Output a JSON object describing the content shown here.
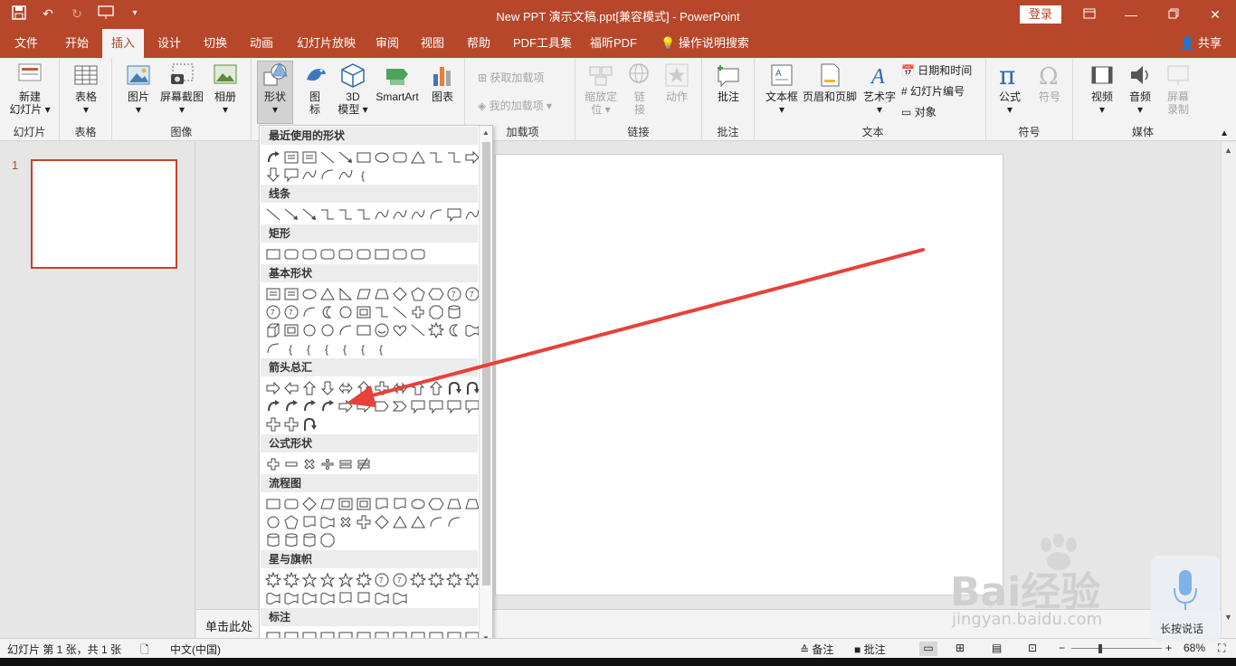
{
  "window": {
    "title": "New PPT 演示文稿.ppt[兼容模式]  -  PowerPoint",
    "login_label": "登录",
    "controls": [
      "restore-ribbon",
      "minimize",
      "maximize",
      "close"
    ]
  },
  "tabs": [
    {
      "label": "文件"
    },
    {
      "label": "开始"
    },
    {
      "label": "插入",
      "active": true
    },
    {
      "label": "设计"
    },
    {
      "label": "切换"
    },
    {
      "label": "动画"
    },
    {
      "label": "幻灯片放映"
    },
    {
      "label": "审阅"
    },
    {
      "label": "视图"
    },
    {
      "label": "帮助"
    },
    {
      "label": "PDF工具集"
    },
    {
      "label": "福昕PDF"
    },
    {
      "label": "操作说明搜索"
    }
  ],
  "share_label": "共享",
  "ribbon": {
    "groups": [
      {
        "label": "幻灯片",
        "buttons": [
          "新建\n幻灯片"
        ]
      },
      {
        "label": "表格",
        "buttons": [
          "表格"
        ]
      },
      {
        "label": "图像",
        "buttons": [
          "图片",
          "屏幕截图",
          "相册"
        ]
      },
      {
        "label": "插图",
        "buttons": [
          "形状",
          "图标",
          "3D 模型",
          "SmartArt",
          "图表"
        ]
      },
      {
        "label": "加载项",
        "buttons": [
          "获取加载项",
          "我的加载项"
        ]
      },
      {
        "label": "链接",
        "buttons": [
          "缩放定位",
          "链接",
          "动作"
        ]
      },
      {
        "label": "批注",
        "buttons": [
          "批注"
        ]
      },
      {
        "label": "文本",
        "buttons": [
          "文本框",
          "页眉和页脚",
          "艺术字",
          "日期和时间",
          "幻灯片编号",
          "对象"
        ]
      },
      {
        "label": "符号",
        "buttons": [
          "公式",
          "符号"
        ]
      },
      {
        "label": "媒体",
        "buttons": [
          "视频",
          "音频",
          "屏幕\n录制"
        ]
      }
    ],
    "new_slide_1": "新建",
    "new_slide_2": "幻灯片",
    "icon1": "图",
    "icon2": "标",
    "model_1": "3D",
    "model_2": "模型",
    "zoom_1": "缩放定",
    "zoom_2": "位",
    "link_1": "链",
    "link_2": "接",
    "rec_1": "屏幕",
    "rec_2": "录制"
  },
  "shapes_panel": {
    "sections": [
      {
        "title": "最近使用的形状"
      },
      {
        "title": "线条"
      },
      {
        "title": "矩形"
      },
      {
        "title": "基本形状"
      },
      {
        "title": "箭头总汇"
      },
      {
        "title": "公式形状"
      },
      {
        "title": "流程图"
      },
      {
        "title": "星与旗帜"
      },
      {
        "title": "标注"
      }
    ]
  },
  "slides": [
    {
      "number": "1"
    }
  ],
  "notes_placeholder": "单击此处",
  "statusbar": {
    "slide_info": "幻灯片 第 1 张，共 1 张",
    "language": "中文(中国)",
    "notes_label": "备注",
    "comments_label": "批注",
    "zoom": "68%"
  },
  "watermark": {
    "brand": "Bai经验",
    "url": "jingyan.baidu.com"
  },
  "voice_button_label": "长按说话",
  "colors": {
    "accent": "#b7472a",
    "annotation_arrow": "#e8403a"
  }
}
